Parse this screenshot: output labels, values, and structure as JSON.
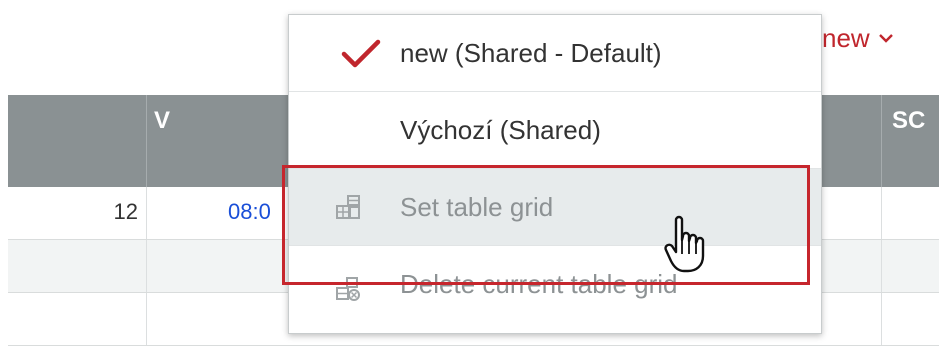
{
  "view_selector": {
    "label": "new"
  },
  "table": {
    "headers": [
      "V",
      "SC"
    ],
    "rows": [
      {
        "num": "12",
        "time": "08:0"
      },
      {
        "num": "",
        "time": ""
      },
      {
        "num": "",
        "time": ""
      }
    ]
  },
  "menu": {
    "items": [
      {
        "label": "new (Shared - Default)",
        "selected": true,
        "icon": "checkmark-icon"
      },
      {
        "label": "Výchozí (Shared)",
        "selected": false
      },
      {
        "label": "Set table grid",
        "icon": "set-grid-icon",
        "disabled": true
      },
      {
        "label": "Delete current table grid",
        "icon": "delete-grid-icon",
        "disabled": true
      }
    ]
  },
  "colors": {
    "accent_red": "#c0262d",
    "header_bg": "#8a9193",
    "link_blue": "#1a4fd8"
  }
}
